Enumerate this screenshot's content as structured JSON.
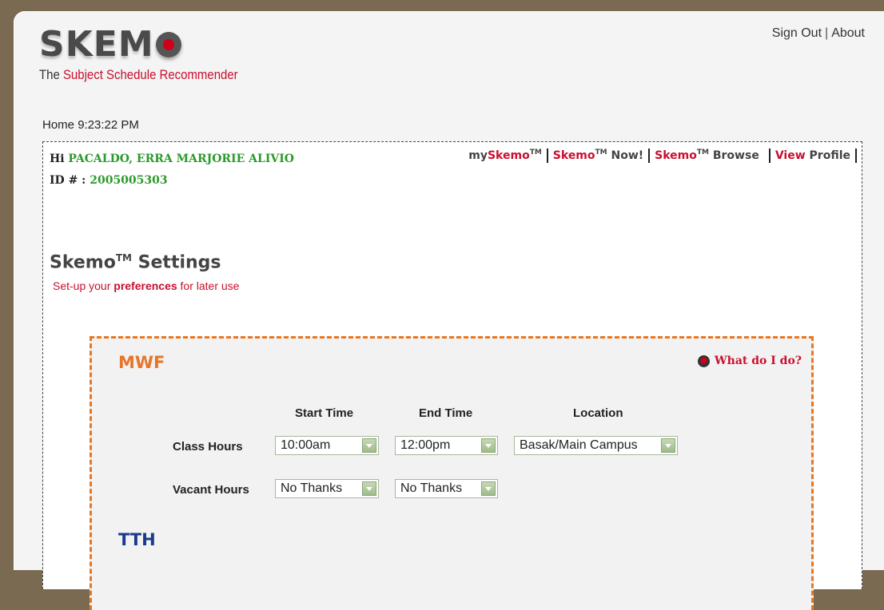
{
  "logo": {
    "word": "SKEM"
  },
  "tagline": {
    "prefix": "The ",
    "highlight": "Subject Schedule Recommender"
  },
  "toplinks": {
    "signout": "Sign Out",
    "sep": "|",
    "about": "About"
  },
  "home": {
    "label": "Home",
    "time": "9:23:22 PM"
  },
  "user": {
    "hi": "Hi",
    "name": "PACALDO, ERRA MARJORIE ALIVIO",
    "id_label": "ID # :",
    "id": "2005005303"
  },
  "nav": {
    "myskemo_prefix": "my",
    "myskemo_brand": "Skemo",
    "tm": "TM",
    "now_brand": "Skemo",
    "now_suffix": "Now!",
    "browse_brand": "Skemo",
    "browse_suffix": "Browse",
    "profile_red": "View",
    "profile_suffix": "Profile"
  },
  "settings": {
    "title": "Skemo",
    "tm": "TM",
    "title_suffix": "Settings",
    "sub_prefix": "Set-up your ",
    "sub_bold": "preferences",
    "sub_suffix": " for later use"
  },
  "mwf": {
    "title": "MWF",
    "help": "What do I do?",
    "headers": {
      "start": "Start Time",
      "end": "End Time",
      "location": "Location"
    },
    "class_hours": {
      "label": "Class Hours",
      "start": "10:00am",
      "end": "12:00pm",
      "location": "Basak/Main Campus"
    },
    "vacant_hours": {
      "label": "Vacant Hours",
      "start": "No Thanks",
      "end": "No Thanks"
    }
  },
  "tth": {
    "title": "TTH"
  },
  "colors": {
    "brand_red": "#c8102e",
    "green": "#2a9a2a",
    "orange": "#e87722",
    "blue": "#1a3a8c"
  }
}
